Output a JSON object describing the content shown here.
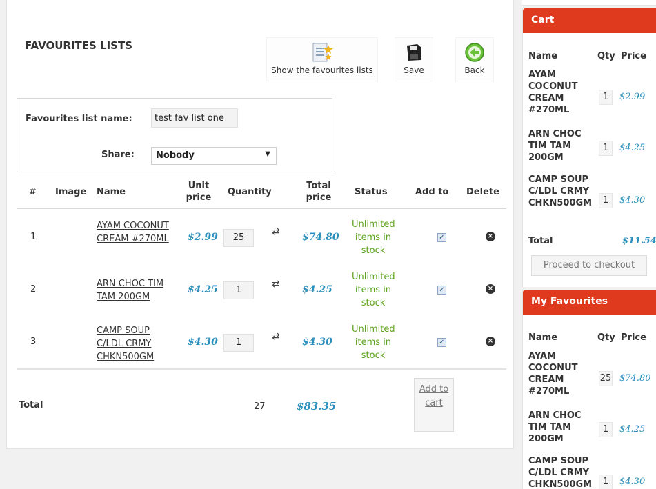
{
  "main": {
    "title": "FAVOURITES LISTS",
    "toolbar": {
      "show_label": "Show the favourites lists",
      "save_label": "Save",
      "back_label": "Back"
    },
    "form": {
      "name_label": "Favourites list name:",
      "name_value": "test fav list one",
      "share_label": "Share:",
      "share_value": "Nobody"
    },
    "table": {
      "headers": {
        "num": "#",
        "image": "Image",
        "name": "Name",
        "unit_price": "Unit price",
        "quantity": "Quantity",
        "total_price": "Total price",
        "status": "Status",
        "add_to": "Add to",
        "delete": "Delete"
      },
      "rows": [
        {
          "num": "1",
          "name": "AYAM COCONUT CREAM #270ML",
          "unit_price": "$2.99",
          "quantity": "25",
          "total": "$74.80",
          "status": "Unlimited items in stock",
          "checked": true
        },
        {
          "num": "2",
          "name": "ARN CHOC TIM TAM 200GM",
          "unit_price": "$4.25",
          "quantity": "1",
          "total": "$4.25",
          "status": "Unlimited items in stock",
          "checked": true
        },
        {
          "num": "3",
          "name": "CAMP SOUP C/LDL CRMY CHKN500GM",
          "unit_price": "$4.30",
          "quantity": "1",
          "total": "$4.30",
          "status": "Unlimited items in stock",
          "checked": true
        }
      ],
      "footer": {
        "label": "Total",
        "quantity": "27",
        "amount": "$83.35",
        "add_to_cart": "Add to cart"
      }
    }
  },
  "sidebar": {
    "cart": {
      "title": "Cart",
      "col_name": "Name",
      "col_qty": "Qty",
      "col_price": "Price",
      "items": [
        {
          "name": "AYAM COCONUT CREAM #270ML",
          "qty": "1",
          "price": "$2.99"
        },
        {
          "name": "ARN CHOC TIM TAM 200GM",
          "qty": "1",
          "price": "$4.25"
        },
        {
          "name": "CAMP SOUP C/LDL CRMY CHKN500GM",
          "qty": "1",
          "price": "$4.30"
        }
      ],
      "total_label": "Total",
      "total": "$11.54",
      "checkout_label": "Proceed to checkout"
    },
    "favourites": {
      "title": "My Favourites",
      "col_name": "Name",
      "col_qty": "Qty",
      "col_price": "Price",
      "items": [
        {
          "name": "AYAM COCONUT CREAM #270ML",
          "qty": "25",
          "price": "$74.80"
        },
        {
          "name": "ARN CHOC TIM TAM 200GM",
          "qty": "1",
          "price": "$4.25"
        },
        {
          "name": "CAMP SOUP C/LDL CRMY CHKN500GM",
          "qty": "1",
          "price": "$4.30"
        }
      ]
    }
  },
  "colors": {
    "accent_red": "#e03a1e",
    "price_blue": "#2a8fbd",
    "status_green": "#5ea41e"
  },
  "icons": {
    "show": "list-star-icon",
    "save": "floppy-disk-icon",
    "back": "back-arrow-icon",
    "refresh": "refresh-icon",
    "delete": "delete-circle-icon"
  }
}
